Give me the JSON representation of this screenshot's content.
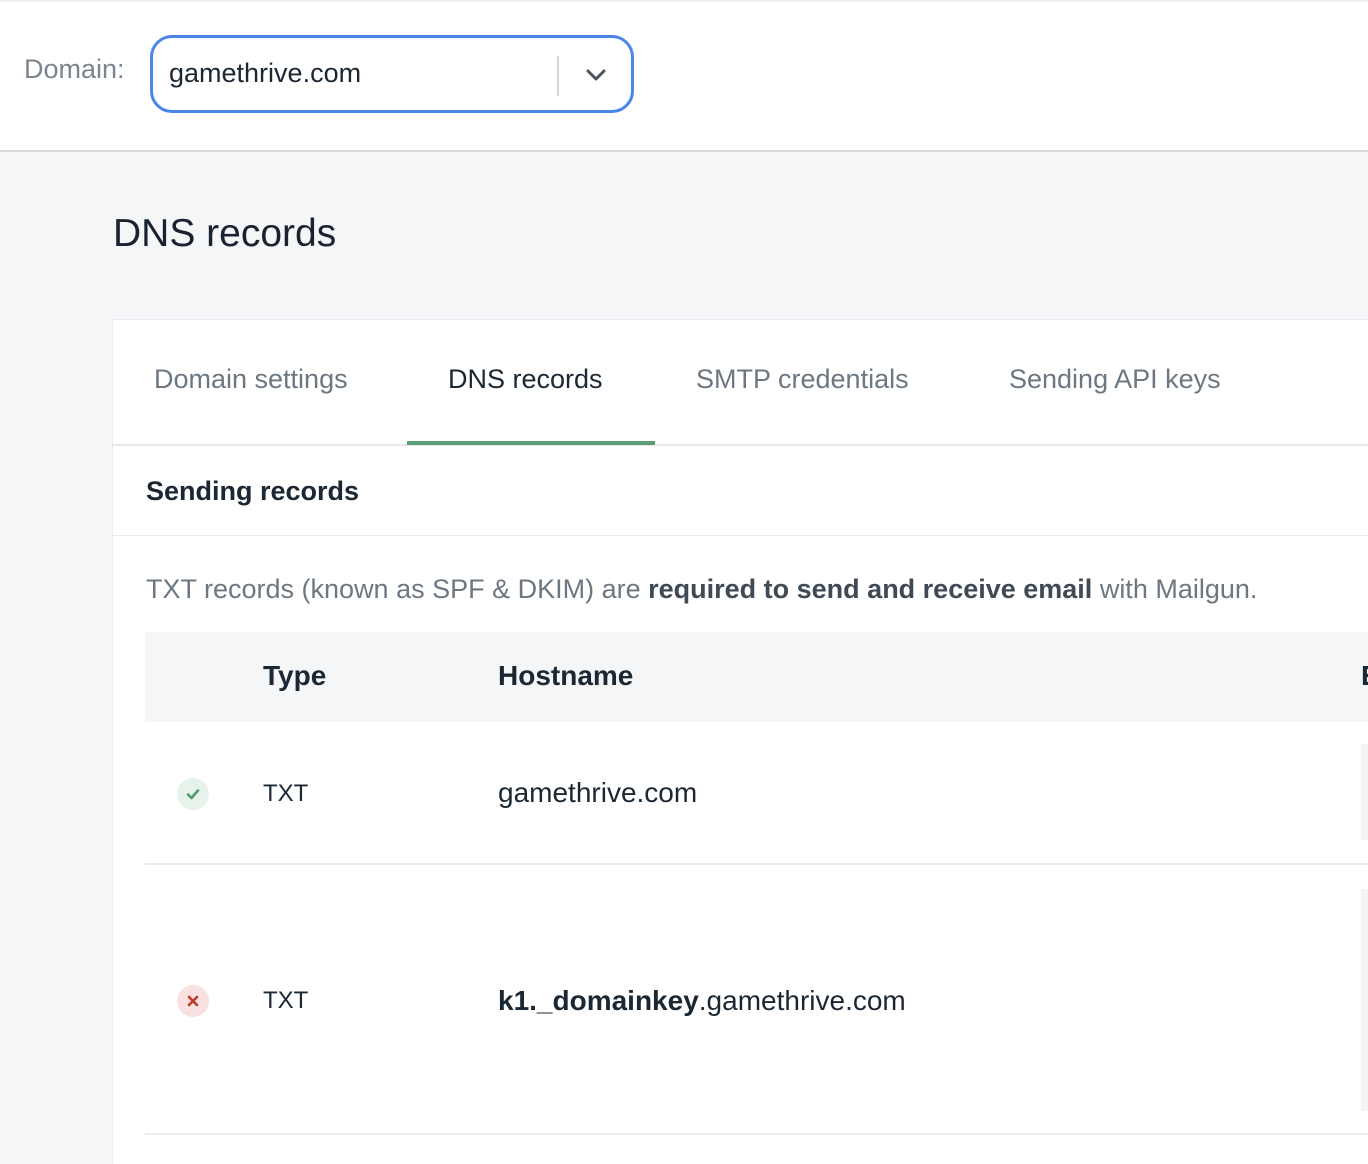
{
  "header": {
    "domain_label": "Domain:",
    "domain_value": "gamethrive.com"
  },
  "page": {
    "title": "DNS records"
  },
  "tabs": [
    {
      "label": "Domain settings",
      "active": false
    },
    {
      "label": "DNS records",
      "active": true
    },
    {
      "label": "SMTP credentials",
      "active": false
    },
    {
      "label": "Sending API keys",
      "active": false
    }
  ],
  "section": {
    "title": "Sending records",
    "intro_prefix": "TXT records (known as SPF & DKIM) are ",
    "intro_bold": "required to send and receive email",
    "intro_suffix": " with Mailgun."
  },
  "table": {
    "columns": [
      "Type",
      "Hostname",
      "E"
    ],
    "rows": [
      {
        "status": "verified",
        "status_icon": "check-icon",
        "type": "TXT",
        "host_prefix": "",
        "host_main": "gamethrive.com"
      },
      {
        "status": "unverified",
        "status_icon": "x-icon",
        "type": "TXT",
        "host_prefix": "k1._domainkey",
        "host_main": ".gamethrive.com"
      }
    ]
  },
  "colors": {
    "accent": "#4a86e8",
    "tab_underline": "#5c9d78",
    "ok": "#4a9a6a",
    "error": "#c0392b"
  }
}
